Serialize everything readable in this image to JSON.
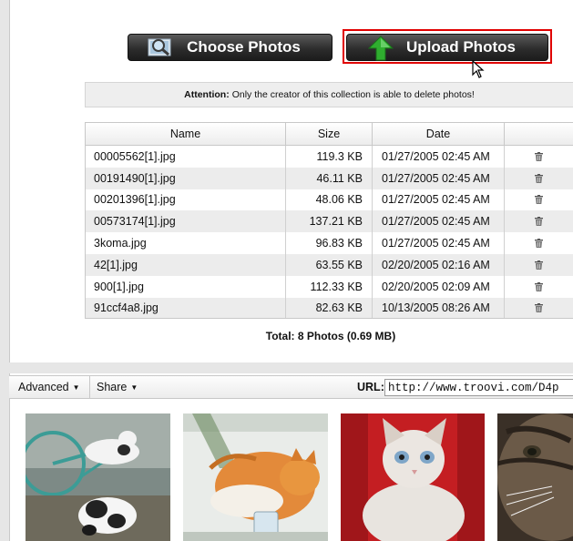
{
  "buttons": {
    "choose": "Choose Photos",
    "upload": "Upload Photos"
  },
  "attention": {
    "label": "Attention:",
    "text": "Only the creator of this collection is able to delete photos!"
  },
  "table": {
    "headers": [
      "Name",
      "Size",
      "Date",
      ""
    ],
    "rows": [
      {
        "name": "00005562[1].jpg",
        "size": "119.3 KB",
        "date": "01/27/2005 02:45 AM"
      },
      {
        "name": "00191490[1].jpg",
        "size": "46.11 KB",
        "date": "01/27/2005 02:45 AM"
      },
      {
        "name": "00201396[1].jpg",
        "size": "48.06 KB",
        "date": "01/27/2005 02:45 AM"
      },
      {
        "name": "00573174[1].jpg",
        "size": "137.21 KB",
        "date": "01/27/2005 02:45 AM"
      },
      {
        "name": "3koma.jpg",
        "size": "96.83 KB",
        "date": "01/27/2005 02:45 AM"
      },
      {
        "name": "42[1].jpg",
        "size": "63.55 KB",
        "date": "02/20/2005 02:16 AM"
      },
      {
        "name": "900[1].jpg",
        "size": "112.33 KB",
        "date": "02/20/2005 02:09 AM"
      },
      {
        "name": "91ccf4a8.jpg",
        "size": "82.63 KB",
        "date": "10/13/2005 08:26 AM"
      }
    ]
  },
  "total": "Total: 8 Photos (0.69 MB)",
  "toolbar": {
    "advanced": "Advanced",
    "share": "Share",
    "url_label": "URL:",
    "url_value": "http://www.troovi.com/D4p"
  },
  "colors": {
    "highlight": "#e00000",
    "button_bg": "#2d2d2d",
    "upload_arrow": "#2fae2f"
  },
  "icons": [
    "magnifier-photo-icon",
    "upload-arrow-icon",
    "trash-icon",
    "caret-down-icon",
    "mouse-cursor-icon"
  ]
}
